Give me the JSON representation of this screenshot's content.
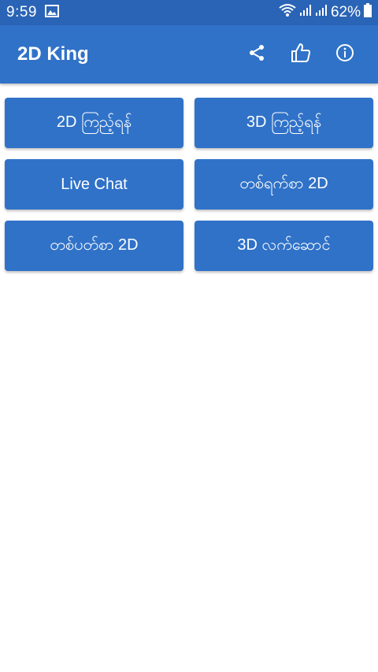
{
  "status_bar": {
    "time": "9:59",
    "battery": "62%",
    "icons": [
      "image-icon",
      "wifi-icon",
      "signal-icon",
      "signal-icon",
      "battery-icon"
    ]
  },
  "app_bar": {
    "title": "2D King",
    "actions": [
      "share-icon",
      "thumbs-up-icon",
      "info-icon"
    ]
  },
  "menu": {
    "buttons": [
      "2D ကြည့်ရန်",
      "3D ကြည့်ရန်",
      "Live Chat",
      "တစ်ရက်စာ 2D",
      "တစ်ပတ်စာ 2D",
      "3D လက်ဆောင်"
    ]
  },
  "colors": {
    "status_bar": "#2a64b6",
    "primary": "#3072c8",
    "text_on_primary": "#ffffff",
    "background": "#ffffff"
  }
}
